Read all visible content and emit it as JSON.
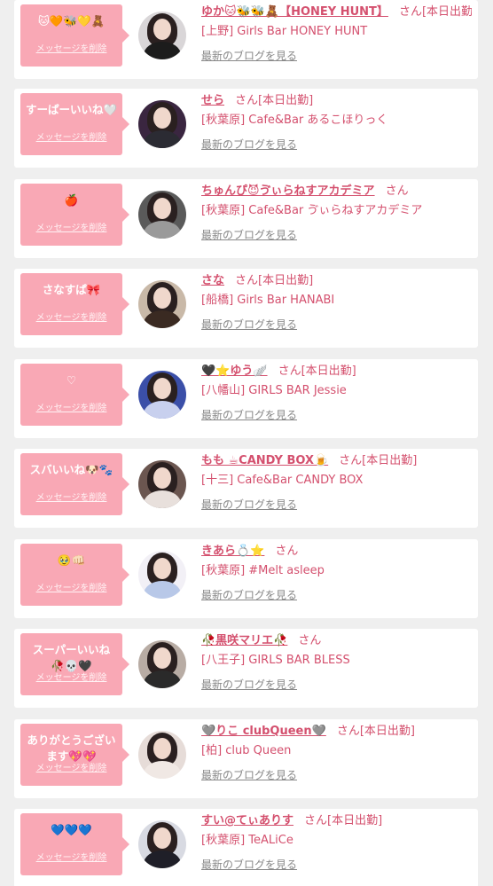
{
  "colors": {
    "background": "#efefef",
    "card": "#ffffff",
    "bubble": "#f9a8b5",
    "accent_text": "#d4506e",
    "link_gray": "#888888"
  },
  "common": {
    "delete_label": "メッセージを削除",
    "blog_label": "最新のブログを見る"
  },
  "items": [
    {
      "message": "🐱🧡🐝💛🧸",
      "name": "ゆか🐱🐝🐝🧸【HONEY HUNT】",
      "suffix": "さん[本日出勤]",
      "shop": "[上野] Girls Bar HONEY HUNT",
      "avatar_bg": "#d9d6d8",
      "avatar_outfit": "#1c1c1c"
    },
    {
      "message": "すーぱーいいね🤍",
      "name": "せら",
      "suffix": "さん[本日出勤]",
      "shop": "[秋葉原] Cafe&Bar あるこほりっく",
      "avatar_bg": "#3a2640",
      "avatar_outfit": "#2b2b33"
    },
    {
      "message": "🍎",
      "name": "ちゅんぴ😈ゔぃらねすアカデミア",
      "suffix": "さん",
      "shop": "[秋葉原] Cafe&Bar ゔぃらねすアカデミア",
      "avatar_bg": "#5a5a5a",
      "avatar_outfit": "#9a9a9a"
    },
    {
      "message": "さなすぱ🎀",
      "name": "さな",
      "suffix": "さん[本日出勤]",
      "shop": "[船橋] Girls Bar HANABI",
      "avatar_bg": "#c9b9a8",
      "avatar_outfit": "#3a2a22"
    },
    {
      "message": "♡",
      "name": "🖤⭐ゆう🪽",
      "suffix": "さん[本日出勤]",
      "shop": "[八幡山] GIRLS BAR Jessie",
      "avatar_bg": "#3b4fa8",
      "avatar_outfit": "#c8d0ee"
    },
    {
      "message": "スバいいね🐶🐾",
      "name": "もも ☕CANDY BOX🍺",
      "suffix": "さん[本日出勤]",
      "shop": "[十三] Cafe&Bar CANDY BOX",
      "avatar_bg": "#6b5650",
      "avatar_outfit": "#e8e0dc"
    },
    {
      "message": "🥹👊🏻",
      "name": "きあら💍⭐",
      "suffix": "さん",
      "shop": "[秋葉原] #Melt asleep",
      "avatar_bg": "#f2f0f6",
      "avatar_outfit": "#b8c8e8"
    },
    {
      "message": "スーパーいいね\n🥀💀🖤",
      "name": "🥀黒咲マリエ🥀",
      "suffix": "さん",
      "shop": "[八王子] GIRLS BAR BLESS",
      "avatar_bg": "#b8aca4",
      "avatar_outfit": "#2a2a2a"
    },
    {
      "message": "ありがとうござい\nます💖💖",
      "name": "🩶りこ clubQueen🩶",
      "suffix": "さん[本日出勤]",
      "shop": "[柏] club Queen",
      "avatar_bg": "#e6dcd8",
      "avatar_outfit": "#f0e8e4"
    },
    {
      "message": "💙💙💙",
      "name": "すい@てぃありす",
      "suffix": "さん[本日出勤]",
      "shop": "[秋葉原] TeALiCe",
      "avatar_bg": "#d8dae2",
      "avatar_outfit": "#1f1f28"
    }
  ]
}
